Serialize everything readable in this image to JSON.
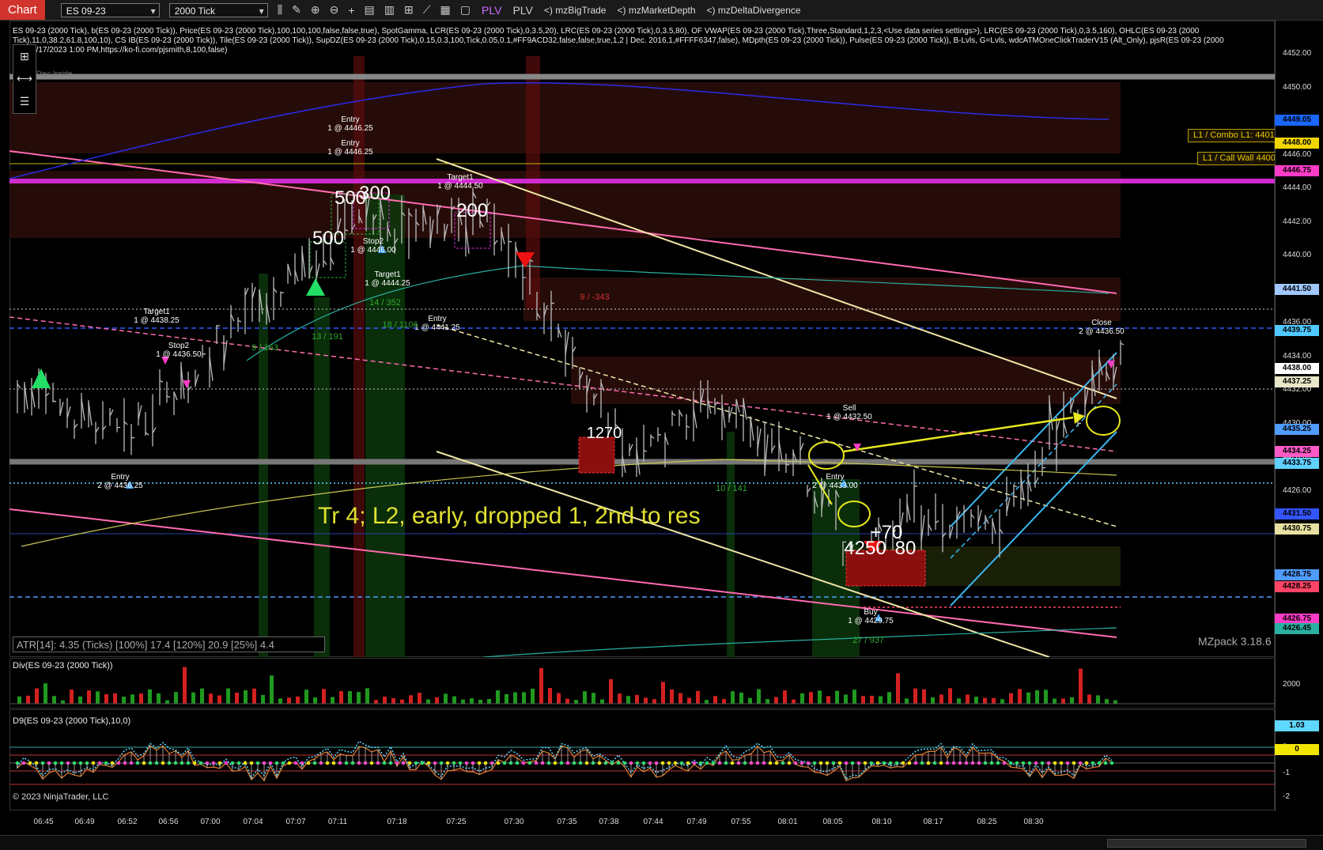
{
  "toolbar": {
    "chart_tab": "Chart",
    "instrument": "ES 09-23",
    "interval": "2000 Tick",
    "plv1": "PLV",
    "plv2": "PLV",
    "indicators": [
      "<) mzBigTrade",
      "<) mzMarketDepth",
      "<) mzDeltaDivergence"
    ]
  },
  "header_text": "ES 09-23 (2000 Tick), b(ES 09-23 (2000 Tick)), Price(ES 09-23 (2000 Tick),100,100,100,false,false,true), SpotGamma, LCR(ES 09-23 (2000 Tick),0,3.5,20), LRC(ES 09-23 (2000 Tick),0,3.5,80), OF VWAP(ES 09-23 (2000 Tick),Three,Standard,1,2,3,<Use data series settings>), LRC(ES 09-23 (2000 Tick),0,3.5,160), OHLC(ES 09-23 (2000 Tick),11,0,38.2,61.8,100,10), CS IB(ES 09-23 (2000 Tick)), Tile(ES 09-23 (2000 Tick)), SupDZ(ES 09-23 (2000 Tick),0.15,0.3,100,Tick,0.05,0.1,#FF9ACD32,false,false,true,1,2 | Dec. 2016,1,#FFFF6347,false), MDpth(ES 09-23 (2000 Tick)), Pulse(ES 09-23 (2000 Tick)), B-Lvls, G=Lvls, wdcATMOneClickTraderV15 (Alt_Only), pjsR(ES 09-23 (2000 Tick),6/17/2023 1:00 PM,https://ko-fi.com/pjsmith,8,100,false)",
  "day_label": "Day: Inside",
  "price_ticks": [
    "4452.00",
    "4450.00",
    "4448.00",
    "4446.00",
    "4444.00",
    "4442.00",
    "4440.00",
    "4438.00",
    "4436.00",
    "4434.00",
    "4432.00",
    "4430.00",
    "4428.00",
    "4426.00"
  ],
  "price_labels": [
    {
      "text": "4449.05",
      "color": "#1a66ff"
    },
    {
      "text": "4448.00",
      "color": "#f2d600"
    },
    {
      "text": "4446.75",
      "color": "#ff3cc8"
    },
    {
      "text": "4441.50",
      "color": "#a0c8ff"
    },
    {
      "text": "4439.75",
      "color": "#4fc8ff"
    },
    {
      "text": "4438.00",
      "color": "#ffffff"
    },
    {
      "text": "4437.25",
      "color": "#e8e8c8"
    },
    {
      "text": "4435.25",
      "color": "#4f9bff"
    },
    {
      "text": "4434.25",
      "color": "#ff5ac8"
    },
    {
      "text": "4433.75",
      "color": "#5fd0ff"
    },
    {
      "text": "4431.50",
      "color": "#3355ff"
    },
    {
      "text": "4430.75",
      "color": "#e8e0a0"
    },
    {
      "text": "4428.75",
      "color": "#4f9bff"
    },
    {
      "text": "4428.25",
      "color": "#ff4466"
    },
    {
      "text": "4426.75",
      "color": "#ff3cc8"
    },
    {
      "text": "4426.45",
      "color": "#2ab0a0"
    }
  ],
  "l1_combo": "L1 / Combo L1: 4401",
  "l1_callwall": "L1 / Call Wall 4400",
  "annotations": [
    {
      "t1": "Entry",
      "t2": "1 @ 4446.25"
    },
    {
      "t1": "Entry",
      "t2": "1 @ 4446.25"
    },
    {
      "t1": "Target1",
      "t2": "1 @ 4444.50"
    },
    {
      "t1": "Stop2",
      "t2": "1 @ 4446.00"
    },
    {
      "t1": "Target1",
      "t2": "1 @ 4444.25"
    },
    {
      "t1": "Entry",
      "t2": "1 @ 4441.25"
    },
    {
      "t1": "Target1",
      "t2": "1 @ 4438.25"
    },
    {
      "t1": "Stop2",
      "t2": "1 @ 4436.50"
    },
    {
      "t1": "Entry",
      "t2": "2 @ 4436.25"
    },
    {
      "t1": "Sell",
      "t2": "1 @ 4432.50"
    },
    {
      "t1": "Entry",
      "t2": "2 @ 4433.00"
    },
    {
      "t1": "Buy",
      "t2": "1 @ 4429.75"
    },
    {
      "t1": "Close",
      "t2": "2 @ 4436.50"
    }
  ],
  "big_numbers": [
    "500",
    "300",
    "500",
    "200",
    "1270",
    "+70",
    "4250",
    "80"
  ],
  "volume_labels": [
    "13 / 191",
    "14 / 352",
    "18 / 1106",
    "9 / -343",
    "10 / 141",
    "27 / 937",
    "9 / 163"
  ],
  "atr": "ATR[14]: 4.35 (Ticks) [100%] 17.4  [120%] 20.9  [25%] 4.4",
  "overlay_text": "Tr 4; L2, early, dropped 1, 2nd to res",
  "mzpack": "MZpack 3.18.6",
  "div_title": "Div(ES 09-23 (2000 Tick))",
  "div_tick": "2000",
  "d9_title": "D9(ES 09-23 (2000 Tick),10,0)",
  "d9_ticks": [
    "1",
    "-1",
    "-2"
  ],
  "d9_labels": [
    {
      "text": "1.03",
      "color": "#5fd8ff"
    },
    {
      "text": "0",
      "color": "#f2e600"
    }
  ],
  "time_ticks": [
    "06:45",
    "06:49",
    "06:52",
    "06:56",
    "07:00",
    "07:04",
    "07:07",
    "07:11",
    "07:18",
    "07:25",
    "07:30",
    "07:35",
    "07:38",
    "07:44",
    "07:49",
    "07:55",
    "08:01",
    "08:05",
    "08:10",
    "08:17",
    "08:25",
    "08:30"
  ],
  "copyright": "© 2023 NinjaTrader, LLC"
}
